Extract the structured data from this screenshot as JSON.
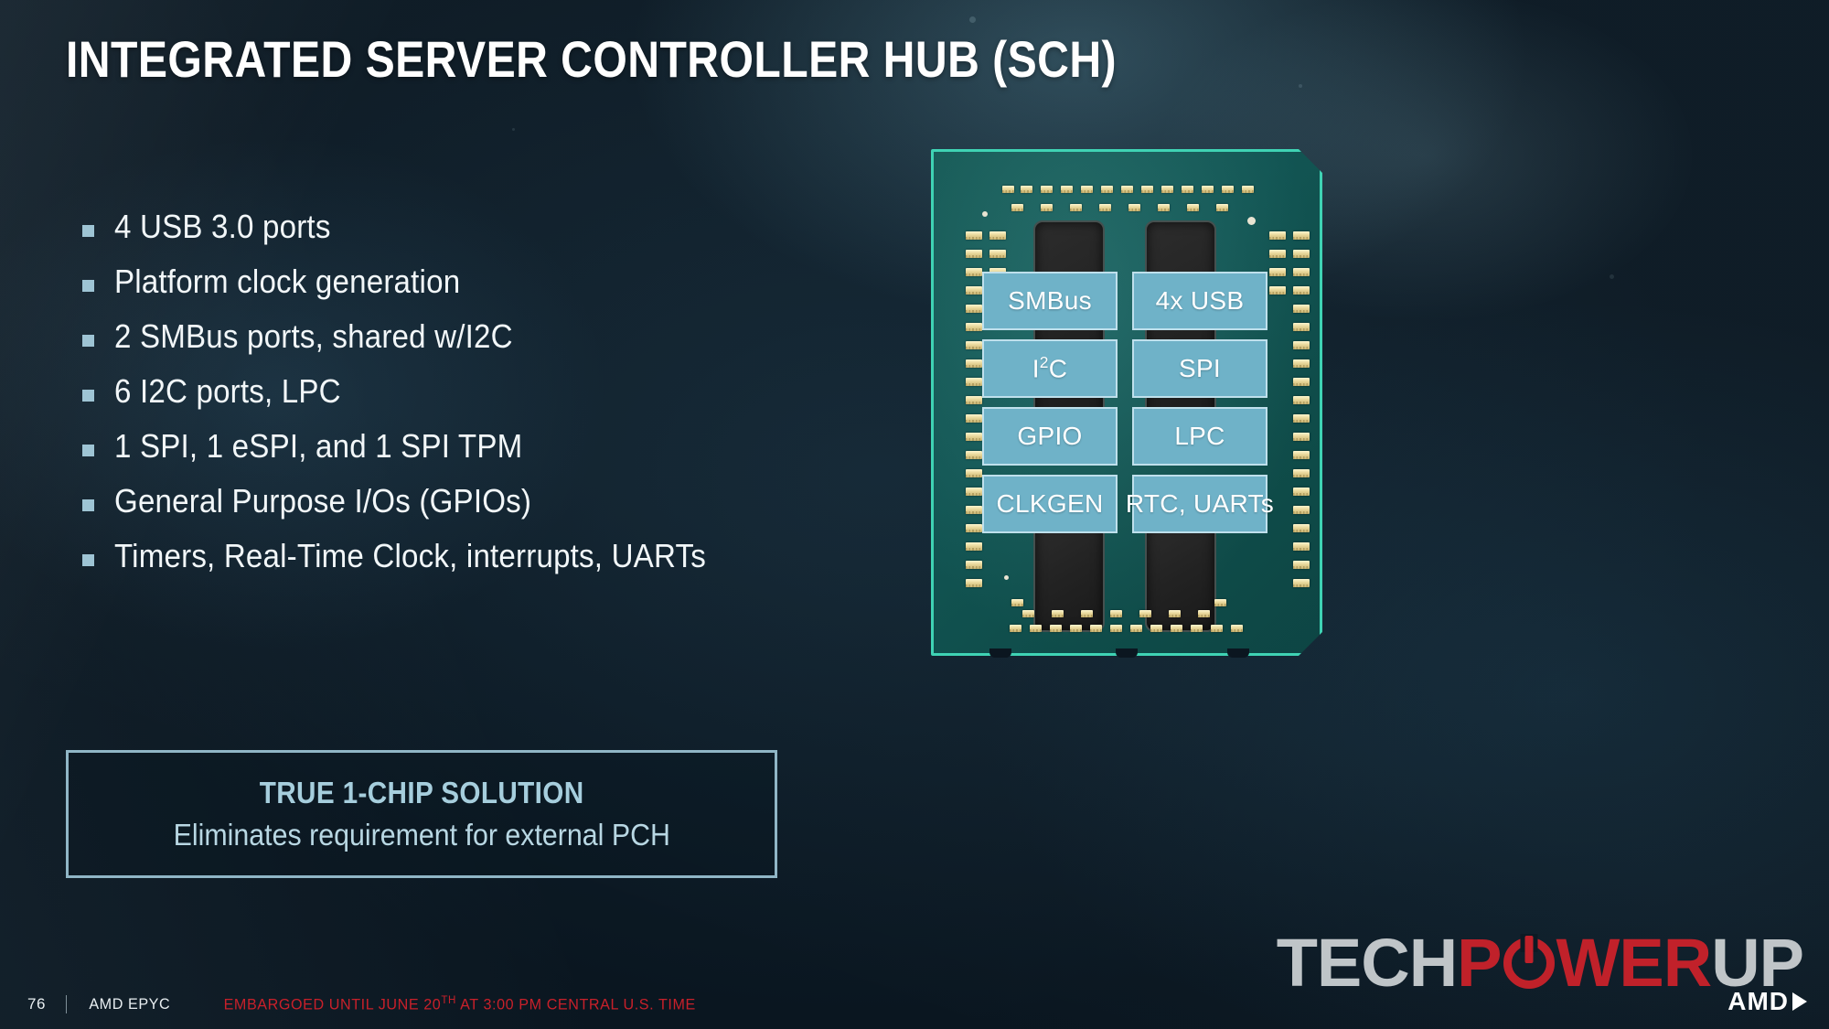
{
  "slide": {
    "title": "INTEGRATED SERVER CONTROLLER HUB (SCH)",
    "accent_color": "#9ec4d4",
    "background_color": "#0d1b26"
  },
  "bullets": [
    {
      "text": "4 USB 3.0 ports"
    },
    {
      "text": "Platform clock generation"
    },
    {
      "text": "2 SMBus ports, shared w/I2C"
    },
    {
      "text": "6 I2C ports, LPC"
    },
    {
      "text": "1 SPI, 1 eSPI, and 1 SPI TPM"
    },
    {
      "text": "General Purpose I/Os (GPIOs)"
    },
    {
      "text": "Timers, Real-Time Clock, interrupts, UARTs"
    }
  ],
  "callout": {
    "title": "TRUE 1-CHIP SOLUTION",
    "subtitle": "Eliminates requirement for external PCH",
    "border_color": "#90b6c6",
    "title_color": "#a6cedd"
  },
  "chip": {
    "substrate_color": "#14605e",
    "edge_color": "#3fd3b4",
    "box_fill": "#6fb2c8",
    "box_border": "#bfe0ec",
    "blocks": [
      {
        "label": "SMBus",
        "column": "left",
        "row": 1
      },
      {
        "label": "4x USB",
        "column": "right",
        "row": 1
      },
      {
        "label": "I2C",
        "label_main": "I",
        "label_sup": "2",
        "label_tail": "C",
        "column": "left",
        "row": 2
      },
      {
        "label": "SPI",
        "column": "right",
        "row": 2
      },
      {
        "label": "GPIO",
        "column": "left",
        "row": 3
      },
      {
        "label": "LPC",
        "column": "right",
        "row": 3
      },
      {
        "label": "CLKGEN",
        "column": "left",
        "row": 4
      },
      {
        "label": "RTC, UARTs",
        "column": "right",
        "row": 4
      }
    ]
  },
  "watermark": {
    "tech": "TECH",
    "p": "P",
    "wer": "WER",
    "up": "UP"
  },
  "amd_logo": {
    "text": "AMD"
  },
  "footer": {
    "page_number": "76",
    "brand": "AMD EPYC",
    "embargo_pre": "EMBARGOED UNTIL JUNE 20",
    "embargo_sup": "TH",
    "embargo_post": " AT 3:00 PM CENTRAL U.S. TIME",
    "embargo_color": "#c8202a"
  }
}
